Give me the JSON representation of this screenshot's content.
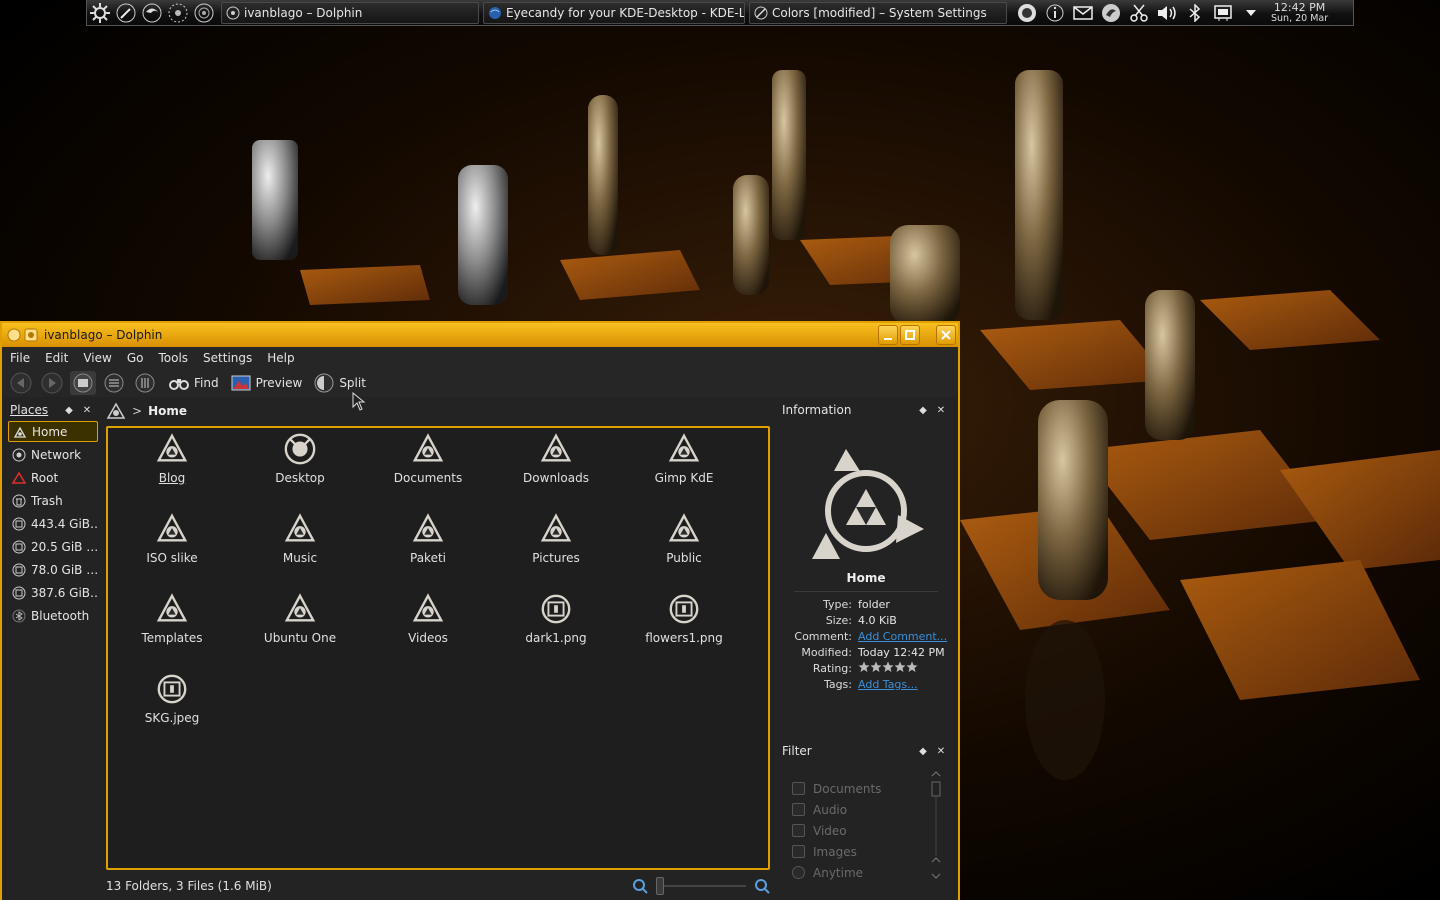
{
  "taskbar": {
    "tasks": [
      {
        "label": "ivanblago – Dolphin"
      },
      {
        "label": "Eyecandy for your KDE-Desktop - KDE-Lo"
      },
      {
        "label": "Colors [modified] – System Settings"
      }
    ],
    "clock": {
      "time": "12:42 PM",
      "date": "Sun, 20 Mar"
    }
  },
  "window": {
    "title": "ivanblago – Dolphin",
    "menu": [
      "File",
      "Edit",
      "View",
      "Go",
      "Tools",
      "Settings",
      "Help"
    ],
    "toolbar": {
      "find": "Find",
      "preview": "Preview",
      "split": "Split"
    }
  },
  "places": {
    "title": "Places",
    "items": [
      {
        "label": "Home",
        "icon": "home-icon"
      },
      {
        "label": "Network",
        "icon": "network-icon"
      },
      {
        "label": "Root",
        "icon": "root-icon"
      },
      {
        "label": "Trash",
        "icon": "trash-icon"
      },
      {
        "label": "443.4 GiB…",
        "icon": "drive-icon"
      },
      {
        "label": "20.5 GiB …",
        "icon": "drive-icon"
      },
      {
        "label": "78.0 GiB …",
        "icon": "drive-icon"
      },
      {
        "label": "387.6 GiB…",
        "icon": "drive-icon"
      },
      {
        "label": "Bluetooth",
        "icon": "bluetooth-icon"
      }
    ]
  },
  "breadcrumb": {
    "current": "Home"
  },
  "files": [
    {
      "name": "Blog",
      "type": "folder"
    },
    {
      "name": "Desktop",
      "type": "desktop"
    },
    {
      "name": "Documents",
      "type": "folder"
    },
    {
      "name": "Downloads",
      "type": "folder"
    },
    {
      "name": "Gimp KdE",
      "type": "folder"
    },
    {
      "name": "ISO slike",
      "type": "folder"
    },
    {
      "name": "Music",
      "type": "folder"
    },
    {
      "name": "Paketi",
      "type": "folder"
    },
    {
      "name": "Pictures",
      "type": "folder"
    },
    {
      "name": "Public",
      "type": "folder"
    },
    {
      "name": "Templates",
      "type": "folder"
    },
    {
      "name": "Ubuntu One",
      "type": "folder"
    },
    {
      "name": "Videos",
      "type": "folder"
    },
    {
      "name": "dark1.png",
      "type": "image"
    },
    {
      "name": "flowers1.png",
      "type": "image"
    },
    {
      "name": "SKG.jpeg",
      "type": "image"
    }
  ],
  "info": {
    "title": "Information",
    "name": "Home",
    "rows": [
      {
        "key": "Type:",
        "value": "folder"
      },
      {
        "key": "Size:",
        "value": "4.0 KiB"
      },
      {
        "key": "Comment:",
        "value": "Add Comment..."
      },
      {
        "key": "Modified:",
        "value": "Today 12:42 PM"
      },
      {
        "key": "Rating:",
        "value": ""
      },
      {
        "key": "Tags:",
        "value": "Add Tags..."
      }
    ]
  },
  "filter": {
    "title": "Filter",
    "items": [
      "Documents",
      "Audio",
      "Video",
      "Images",
      "Anytime"
    ]
  },
  "status": {
    "text": "13 Folders, 3 Files (1.6 MiB)"
  },
  "colors": {
    "accent": "#e0a000",
    "window_bg": "#232323",
    "link": "#3a8fd8"
  }
}
